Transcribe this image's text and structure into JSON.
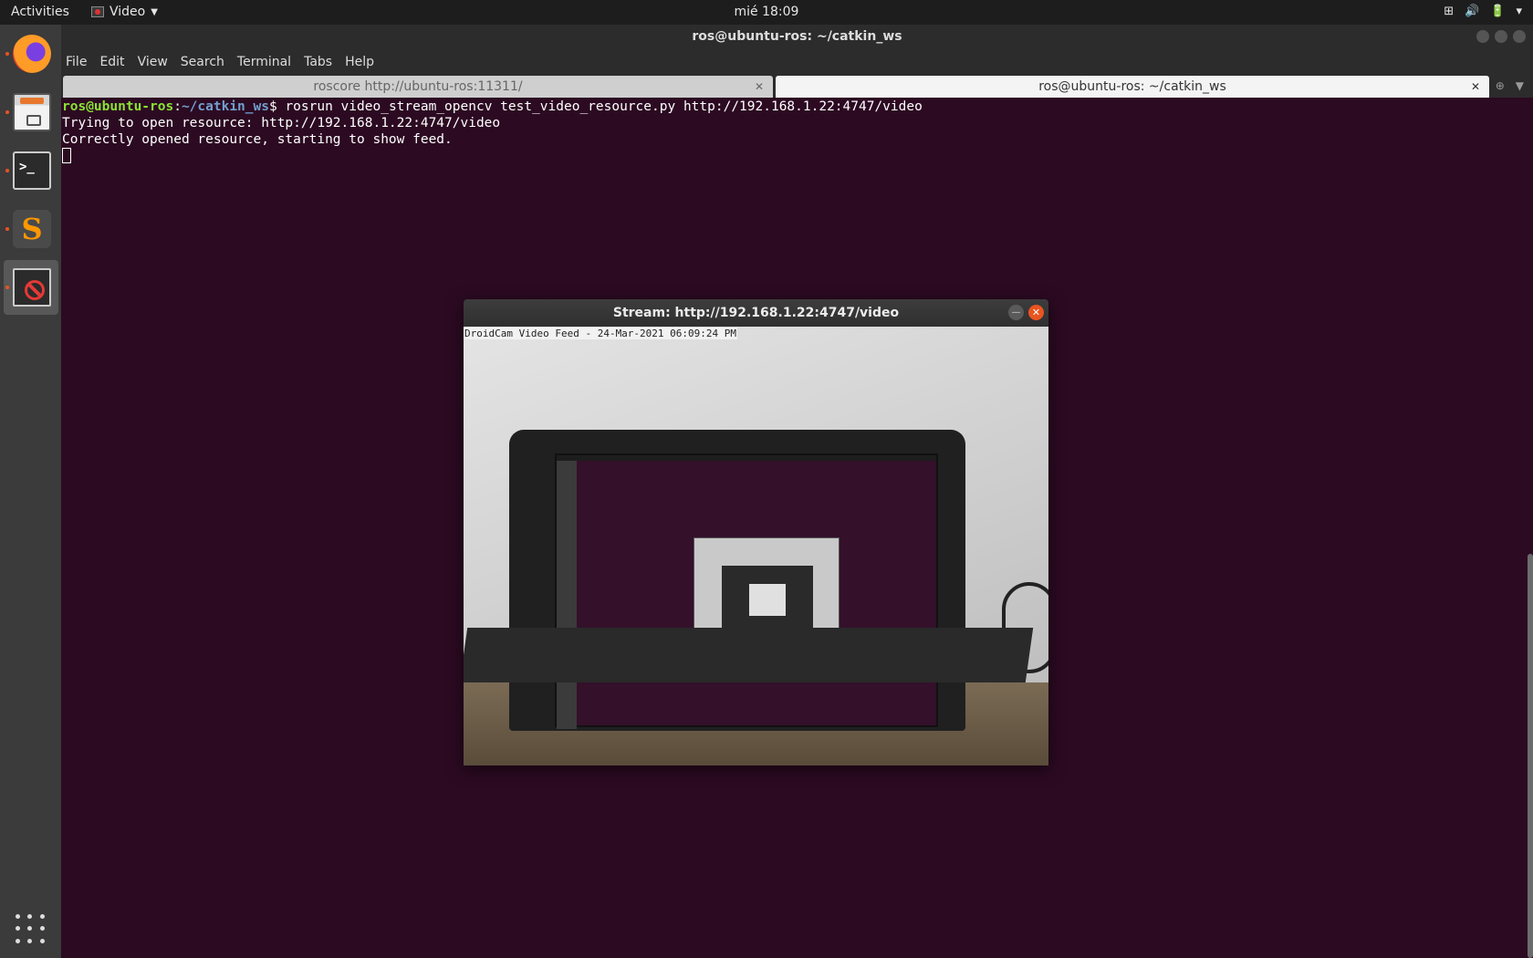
{
  "topbar": {
    "activities": "Activities",
    "app_name": "Video",
    "clock": "mié 18:09",
    "tray_network": "⊞",
    "tray_volume": "🔊",
    "tray_power": "🔋",
    "tray_caret": "▾"
  },
  "terminal": {
    "window_title": "ros@ubuntu-ros: ~/catkin_ws",
    "menu": [
      "File",
      "Edit",
      "View",
      "Search",
      "Terminal",
      "Tabs",
      "Help"
    ],
    "tabs": [
      {
        "label": "roscore http://ubuntu-ros:11311/",
        "active": false
      },
      {
        "label": "ros@ubuntu-ros: ~/catkin_ws",
        "active": true
      }
    ],
    "prompt_user": "ros@ubuntu-ros",
    "prompt_sep": ":",
    "prompt_path": "~/catkin_ws",
    "prompt_dollar": "$ ",
    "command": "rosrun video_stream_opencv test_video_resource.py http://192.168.1.22:4747/video",
    "output": [
      "Trying to open resource: http://192.168.1.22:4747/video",
      "Correctly opened resource, starting to show feed."
    ]
  },
  "stream_window": {
    "title": "Stream: http://192.168.1.22:4747/video",
    "overlay": "DroidCam Video Feed - 24-Mar-2021 06:09:24 PM"
  },
  "dock": {
    "items": [
      "firefox-icon",
      "files-icon",
      "terminal-icon",
      "sublime-text-icon",
      "video-app-icon"
    ],
    "grid": "show-applications-icon"
  },
  "colors": {
    "terminal_bg": "#2c0a22",
    "prompt_user": "#8ae234",
    "prompt_path": "#729fcf",
    "accent": "#e95420"
  }
}
